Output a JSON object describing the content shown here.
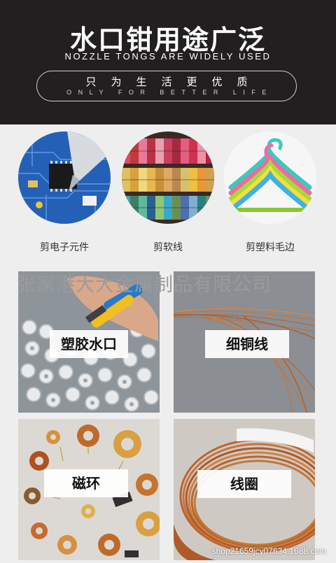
{
  "header": {
    "title": "水口钳用途广泛",
    "subtitle": "NOZZLE TONGS ARE WIDELY USED",
    "slogan_cn": "只为生活更优质",
    "slogan_en": "ONLY FOR BETTER LIFE"
  },
  "uses": [
    {
      "label": "剪电子元件",
      "icon": "circuit-board"
    },
    {
      "label": "剪软线",
      "icon": "wire-spools"
    },
    {
      "label": "剪塑料毛边",
      "icon": "plastic-hangers"
    }
  ],
  "materials": [
    {
      "label": "塑胶水口",
      "icon": "plastic-gates"
    },
    {
      "label": "细铜线",
      "icon": "fine-copper-wire"
    },
    {
      "label": "磁环",
      "icon": "magnetic-rings"
    },
    {
      "label": "线圈",
      "icon": "coil"
    }
  ],
  "watermark": "张家港大大金属制品有限公司",
  "footer_url": "shop21659jcy07634.1688.com",
  "colors": {
    "header_bg": "#221f20",
    "page_bg": "#eeeeee",
    "copper": "#c8733a"
  }
}
